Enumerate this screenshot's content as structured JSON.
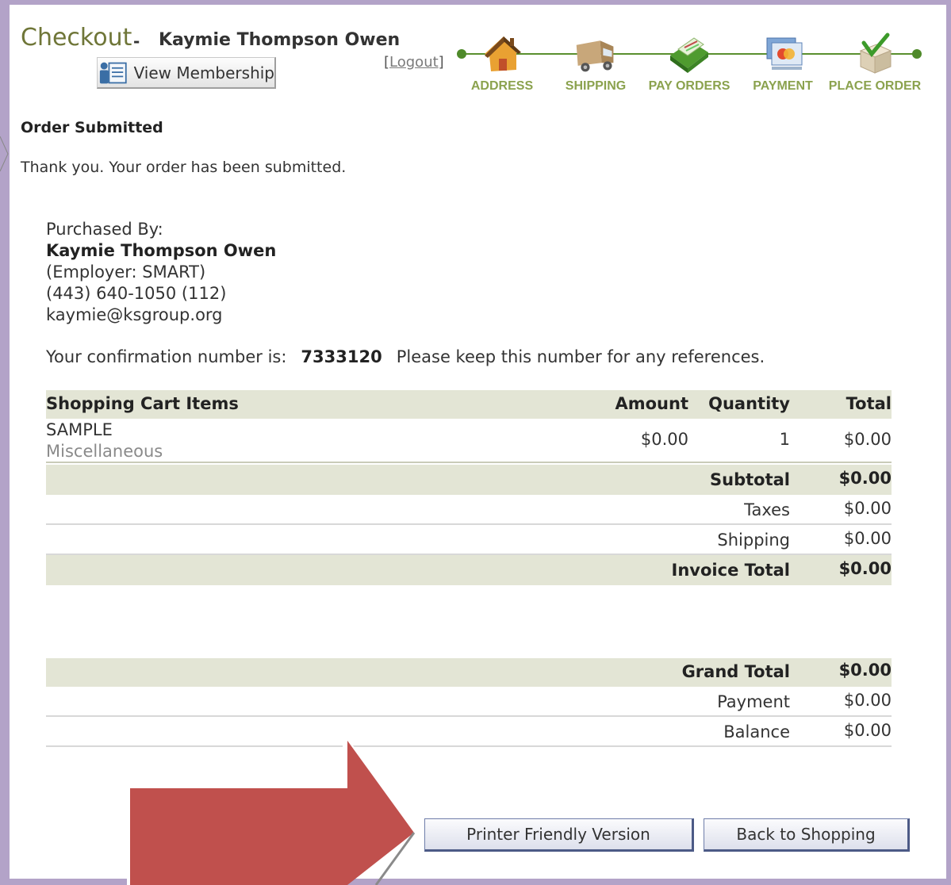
{
  "header": {
    "title": "Checkout",
    "separator": "-",
    "user_name": "Kaymie Thompson Owen",
    "view_membership_label": "View Membership",
    "logout_label": "Logout",
    "logout_bracket_open": "[",
    "logout_bracket_close": "]"
  },
  "steps": [
    {
      "label": "ADDRESS",
      "icon": "house-icon"
    },
    {
      "label": "SHIPPING",
      "icon": "truck-icon"
    },
    {
      "label": "PAY ORDERS",
      "icon": "money-icon"
    },
    {
      "label": "PAYMENT",
      "icon": "credit-card-icon"
    },
    {
      "label": "PLACE ORDER",
      "icon": "package-check-icon"
    }
  ],
  "status": {
    "heading": "Order Submitted",
    "message": "Thank you. Your order has been submitted."
  },
  "purchaser": {
    "label": "Purchased By:",
    "name": "Kaymie Thompson Owen",
    "employer": "(Employer: SMART)",
    "phone": "(443) 640-1050 (112)",
    "email": "kaymie@ksgroup.org"
  },
  "confirmation": {
    "prefix": "Your confirmation number is:",
    "number": "7333120",
    "suffix": "Please keep this number for any references."
  },
  "cart": {
    "headers": {
      "item": "Shopping Cart Items",
      "amount": "Amount",
      "quantity": "Quantity",
      "total": "Total"
    },
    "items": [
      {
        "name": "SAMPLE",
        "category": "Miscellaneous",
        "amount": "$0.00",
        "quantity": "1",
        "total": "$0.00"
      }
    ],
    "subtotal": {
      "label": "Subtotal",
      "value": "$0.00"
    },
    "taxes": {
      "label": "Taxes",
      "value": "$0.00"
    },
    "shipping": {
      "label": "Shipping",
      "value": "$0.00"
    },
    "invoice_total": {
      "label": "Invoice Total",
      "value": "$0.00"
    }
  },
  "summary": {
    "grand_total": {
      "label": "Grand Total",
      "value": "$0.00"
    },
    "payment": {
      "label": "Payment",
      "value": "$0.00"
    },
    "balance": {
      "label": "Balance",
      "value": "$0.00"
    }
  },
  "buttons": {
    "printer_friendly": "Printer Friendly Version",
    "back_to_shopping": "Back to Shopping"
  },
  "colors": {
    "frame": "#b3a3c8",
    "title": "#6f7638",
    "step_label": "#8ba24e",
    "band": "#e3e5d5",
    "arrow": "#c0504d"
  }
}
